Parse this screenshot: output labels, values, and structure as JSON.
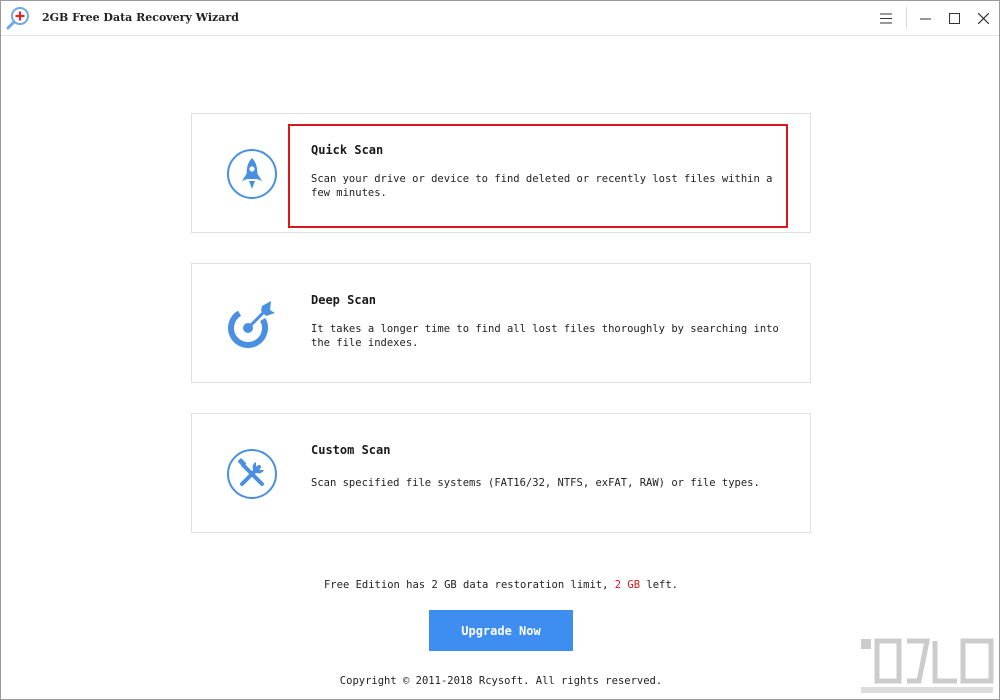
{
  "window": {
    "title": "2GB Free Data Recovery Wizard",
    "controls": [
      "menu-icon",
      "minimize-icon",
      "maximize-icon",
      "close-icon"
    ]
  },
  "scan_options": [
    {
      "title": "Quick Scan",
      "description": "Scan your drive or device to find deleted or recently lost files within a few minutes.",
      "icon": "rocket-icon",
      "selected": true
    },
    {
      "title": "Deep Scan",
      "description": "It takes a longer time to find all lost files thoroughly by searching into the file indexes.",
      "icon": "target-arrow-icon",
      "selected": false
    },
    {
      "title": "Custom Scan",
      "description": "Scan specified file systems (FAT16/32, NTFS, exFAT, RAW) or file types.",
      "icon": "tools-icon",
      "selected": false
    }
  ],
  "footer": {
    "limit_prefix": "Free Edition has 2 GB data restoration limit, ",
    "limit_remaining": "2 GB",
    "limit_suffix": " left.",
    "upgrade_label": "Upgrade Now",
    "copyright": "Copyright © 2011-2018 Rcysoft. All rights reserved."
  },
  "colors": {
    "accent": "#3d8ef0",
    "highlight": "#d9171c",
    "icon_blue": "#4a90e2"
  }
}
